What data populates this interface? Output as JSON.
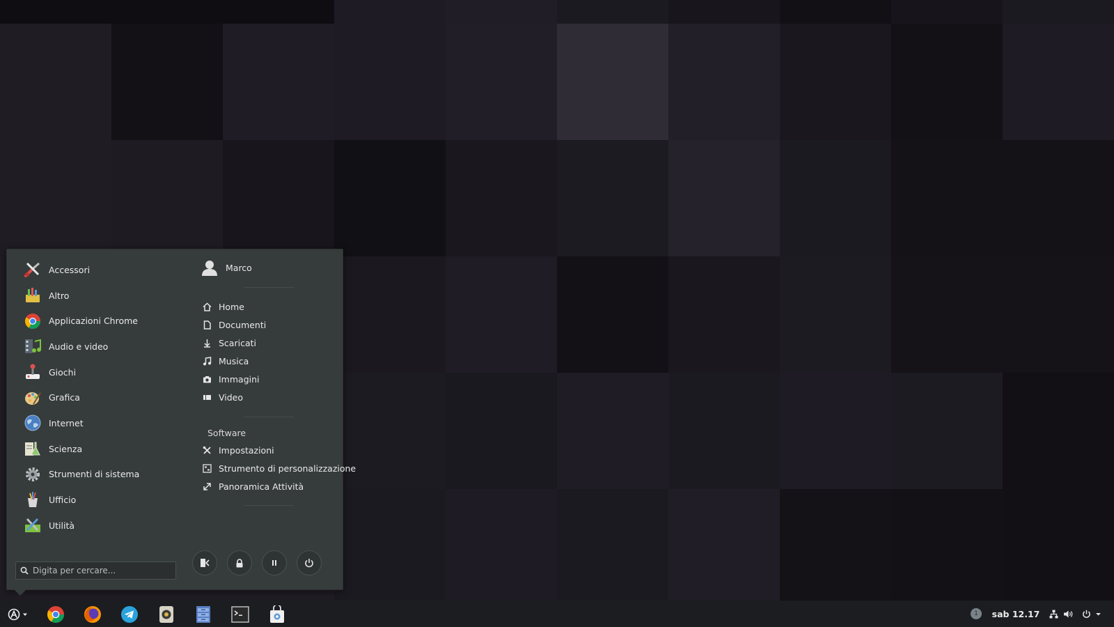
{
  "colors": {
    "menu_bg": "#363c3b",
    "taskbar_bg": "#1b1d21",
    "text": "#eaeaea"
  },
  "wallpaper": {
    "tiles": [
      [
        "#0f0d12",
        "#0f0d12",
        "#0f0d12",
        "#1e1b25",
        "#201d26",
        "#1c1a21",
        "#18161c",
        "#121015",
        "#17151b",
        "#1c1a21"
      ],
      [
        "#1f1c24",
        "#131116",
        "#1f1c25",
        "#1e1b24",
        "#211e27",
        "#302c36",
        "#221f29",
        "#1a181e",
        "#131116",
        "#1e1b24"
      ],
      [
        "#1f1c24",
        "#1e1b23",
        "#18161c",
        "#111014",
        "#1a181e",
        "#1d1b22",
        "#25222c",
        "#1c1a21",
        "#141216",
        "#141216"
      ],
      [
        "#1f1c24",
        "#1f1c24",
        "#1f1c24",
        "#1b191f",
        "#1f1c25",
        "#131116",
        "#1a181e",
        "#1d1b22",
        "#151317",
        "#151317"
      ],
      [
        "#1f1c24",
        "#1f1c24",
        "#1f1c24",
        "#1d1b22",
        "#1b1920",
        "#1f1c25",
        "#1c1a21",
        "#1e1b24",
        "#1d1b22",
        "#121015"
      ],
      [
        "#1f1c24",
        "#1f1c24",
        "#1f1c24",
        "#1c1a21",
        "#1e1b24",
        "#1c1a21",
        "#201d27",
        "#141216",
        "#131116",
        "#121015"
      ]
    ]
  },
  "menu": {
    "categories": [
      {
        "label": "Accessori",
        "icon": "accessories-icon"
      },
      {
        "label": "Altro",
        "icon": "other-icon"
      },
      {
        "label": "Applicazioni Chrome",
        "icon": "chrome-icon"
      },
      {
        "label": "Audio e video",
        "icon": "multimedia-icon"
      },
      {
        "label": "Giochi",
        "icon": "games-icon"
      },
      {
        "label": "Grafica",
        "icon": "graphics-icon"
      },
      {
        "label": "Internet",
        "icon": "internet-icon"
      },
      {
        "label": "Scienza",
        "icon": "science-icon"
      },
      {
        "label": "Strumenti di sistema",
        "icon": "system-tools-icon"
      },
      {
        "label": "Ufficio",
        "icon": "office-icon"
      },
      {
        "label": "Utilità",
        "icon": "utilities-icon"
      }
    ],
    "user": {
      "name": "Marco"
    },
    "places": [
      {
        "label": "Home",
        "icon": "home-icon"
      },
      {
        "label": "Documenti",
        "icon": "document-icon"
      },
      {
        "label": "Scaricati",
        "icon": "download-icon"
      },
      {
        "label": "Musica",
        "icon": "music-icon"
      },
      {
        "label": "Immagini",
        "icon": "camera-icon"
      },
      {
        "label": "Video",
        "icon": "video-icon"
      }
    ],
    "software_title": "Software",
    "software": [
      {
        "label": "Impostazioni",
        "icon": "settings-icon"
      },
      {
        "label": "Strumento di personalizzazione",
        "icon": "tweak-tool-icon"
      },
      {
        "label": "Panoramica Attività",
        "icon": "activities-overview-icon"
      }
    ],
    "search": {
      "placeholder": "Digita per cercare..."
    },
    "session_buttons": [
      {
        "name": "switch-user-button",
        "icon": "switch-user-icon"
      },
      {
        "name": "lock-button",
        "icon": "lock-icon"
      },
      {
        "name": "suspend-button",
        "icon": "pause-icon"
      },
      {
        "name": "power-button",
        "icon": "power-icon"
      }
    ]
  },
  "taskbar": {
    "apps": [
      {
        "name": "chrome",
        "icon": "chrome-icon"
      },
      {
        "name": "firefox",
        "icon": "firefox-icon"
      },
      {
        "name": "telegram",
        "icon": "telegram-icon"
      },
      {
        "name": "rhythmbox",
        "icon": "audio-player-icon"
      },
      {
        "name": "files",
        "icon": "files-icon"
      },
      {
        "name": "terminal",
        "icon": "terminal-icon"
      },
      {
        "name": "software",
        "icon": "software-center-icon"
      }
    ],
    "workspace_indicator": "1",
    "clock": "sab 12.17"
  }
}
